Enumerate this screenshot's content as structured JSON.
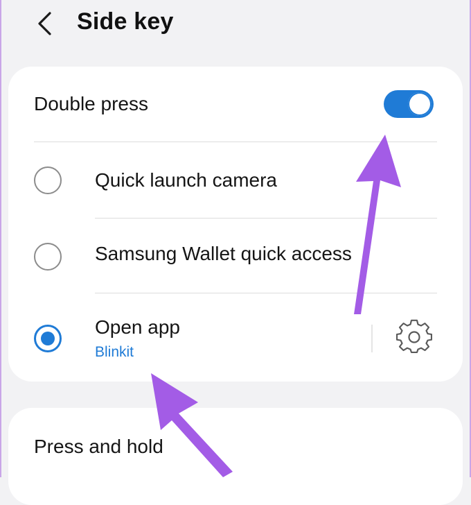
{
  "header": {
    "title": "Side key",
    "back_icon": "chevron-left-icon"
  },
  "double_press": {
    "label": "Double press",
    "toggle_on": true,
    "accent_color": "#1f7bd6",
    "options": [
      {
        "label": "Quick launch camera",
        "selected": false
      },
      {
        "label": "Samsung Wallet quick access",
        "selected": false
      },
      {
        "label": "Open app",
        "sublabel": "Blinkit",
        "selected": true
      }
    ],
    "settings_icon": "gear-icon"
  },
  "press_and_hold": {
    "label": "Press and hold"
  },
  "annotations": {
    "arrow_color": "#a35ce6"
  }
}
